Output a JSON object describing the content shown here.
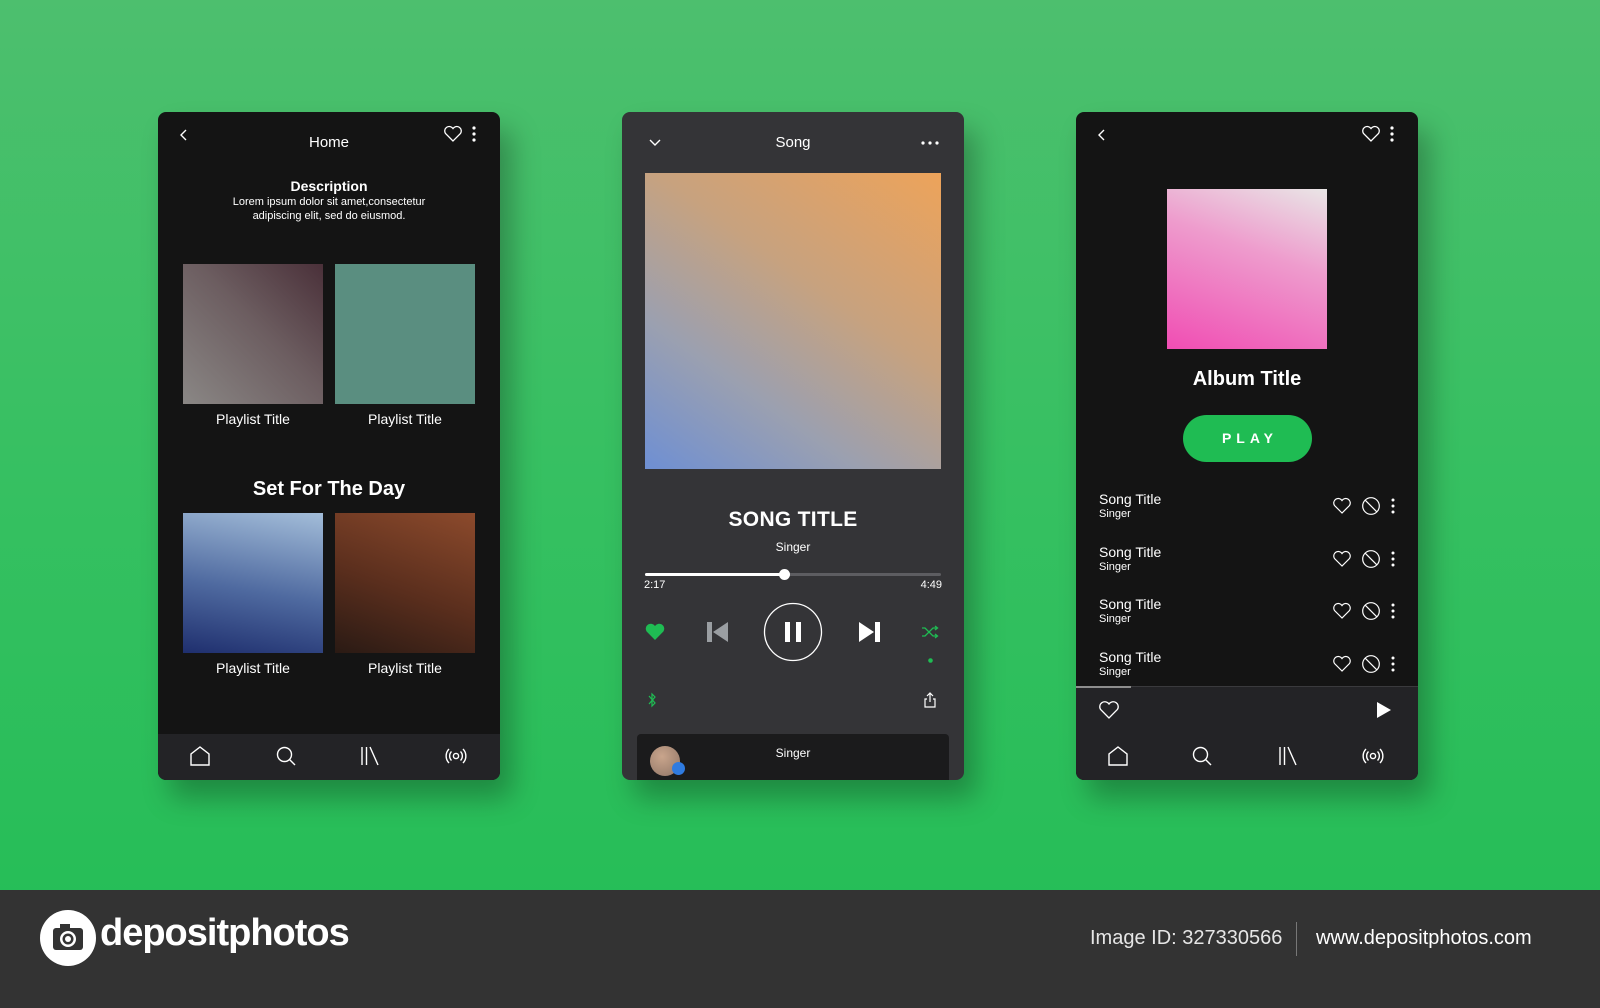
{
  "colors": {
    "background": "#37c062",
    "spotify_green": "#1fbc53",
    "phone_dark": "#141414",
    "player_gray": "#343437",
    "footer": "#333333"
  },
  "home_screen": {
    "title": "Home",
    "icons": [
      "back-icon",
      "heart-icon",
      "more-vertical-icon"
    ],
    "description_title": "Description",
    "description_text": "Lorem ipsum dolor sit amet,consectetur adipiscing elit, sed do eiusmod.",
    "playlists_top": [
      {
        "label": "Playlist Title"
      },
      {
        "label": "Playlist Title"
      }
    ],
    "section_title": "Set For The Day",
    "playlists_bottom": [
      {
        "label": "Playlist Title"
      },
      {
        "label": "Playlist Title"
      }
    ],
    "nav": [
      "home-icon",
      "search-icon",
      "library-icon",
      "radio-icon"
    ]
  },
  "song_screen": {
    "title": "Song",
    "song_title": "SONG TITLE",
    "singer": "Singer",
    "elapsed": "2:17",
    "duration": "4:49",
    "progress_fraction": 0.47,
    "liked": true,
    "shuffle_active": true,
    "mini_player_name": "Singer"
  },
  "album_screen": {
    "album_title": "Album Title",
    "play_label": "PLAY",
    "songs": [
      {
        "title": "Song Title",
        "singer": "Singer"
      },
      {
        "title": "Song Title",
        "singer": "Singer"
      },
      {
        "title": "Song Title",
        "singer": "Singer"
      },
      {
        "title": "Song Title",
        "singer": "Singer"
      }
    ],
    "player_progress_fraction": 0.16
  },
  "footer": {
    "brand": "depositphotos",
    "image_id": "Image ID: 327330566",
    "site": "www.depositphotos.com"
  }
}
